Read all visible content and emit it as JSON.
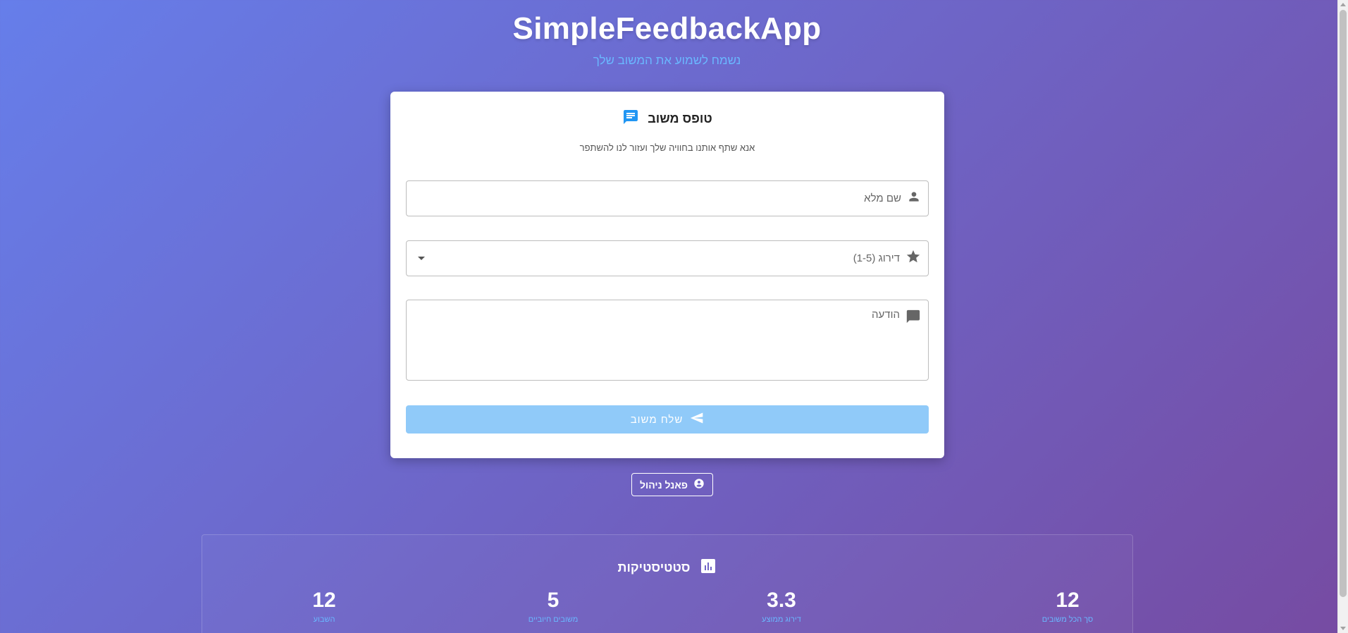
{
  "header": {
    "title": "SimpleFeedbackApp",
    "subtitle": "נשמח לשמוע את המשוב שלך"
  },
  "form": {
    "title": "טופס משוב",
    "description": "אנא שתף אותנו בחוויה שלך ועזור לנו להשתפר",
    "name_label": "שם מלא",
    "rating_label": "דירוג (1-5)",
    "message_label": "הודעה",
    "submit_label": "שלח משוב",
    "icons": {
      "header": "feedback-icon",
      "name": "person-icon",
      "rating": "star-icon",
      "message": "message-icon",
      "submit": "send-icon"
    }
  },
  "admin": {
    "label": "פאנל ניהול",
    "icon": "admin-shield-icon"
  },
  "stats": {
    "title": "סטטיסטיקות",
    "icon": "bar-chart-icon",
    "items": [
      {
        "value": "12",
        "label": "סך הכל משובים"
      },
      {
        "value": "3.3",
        "label": "דירוג ממוצע"
      },
      {
        "value": "5",
        "label": "משובים חיוביים"
      },
      {
        "value": "12",
        "label": "השבוע"
      }
    ]
  },
  "colors": {
    "accent": "#2196f3",
    "submit_disabled": "#90caf9",
    "subtitle": "#6ab7ff",
    "gradient_start": "#667eea",
    "gradient_end": "#764ba2"
  }
}
